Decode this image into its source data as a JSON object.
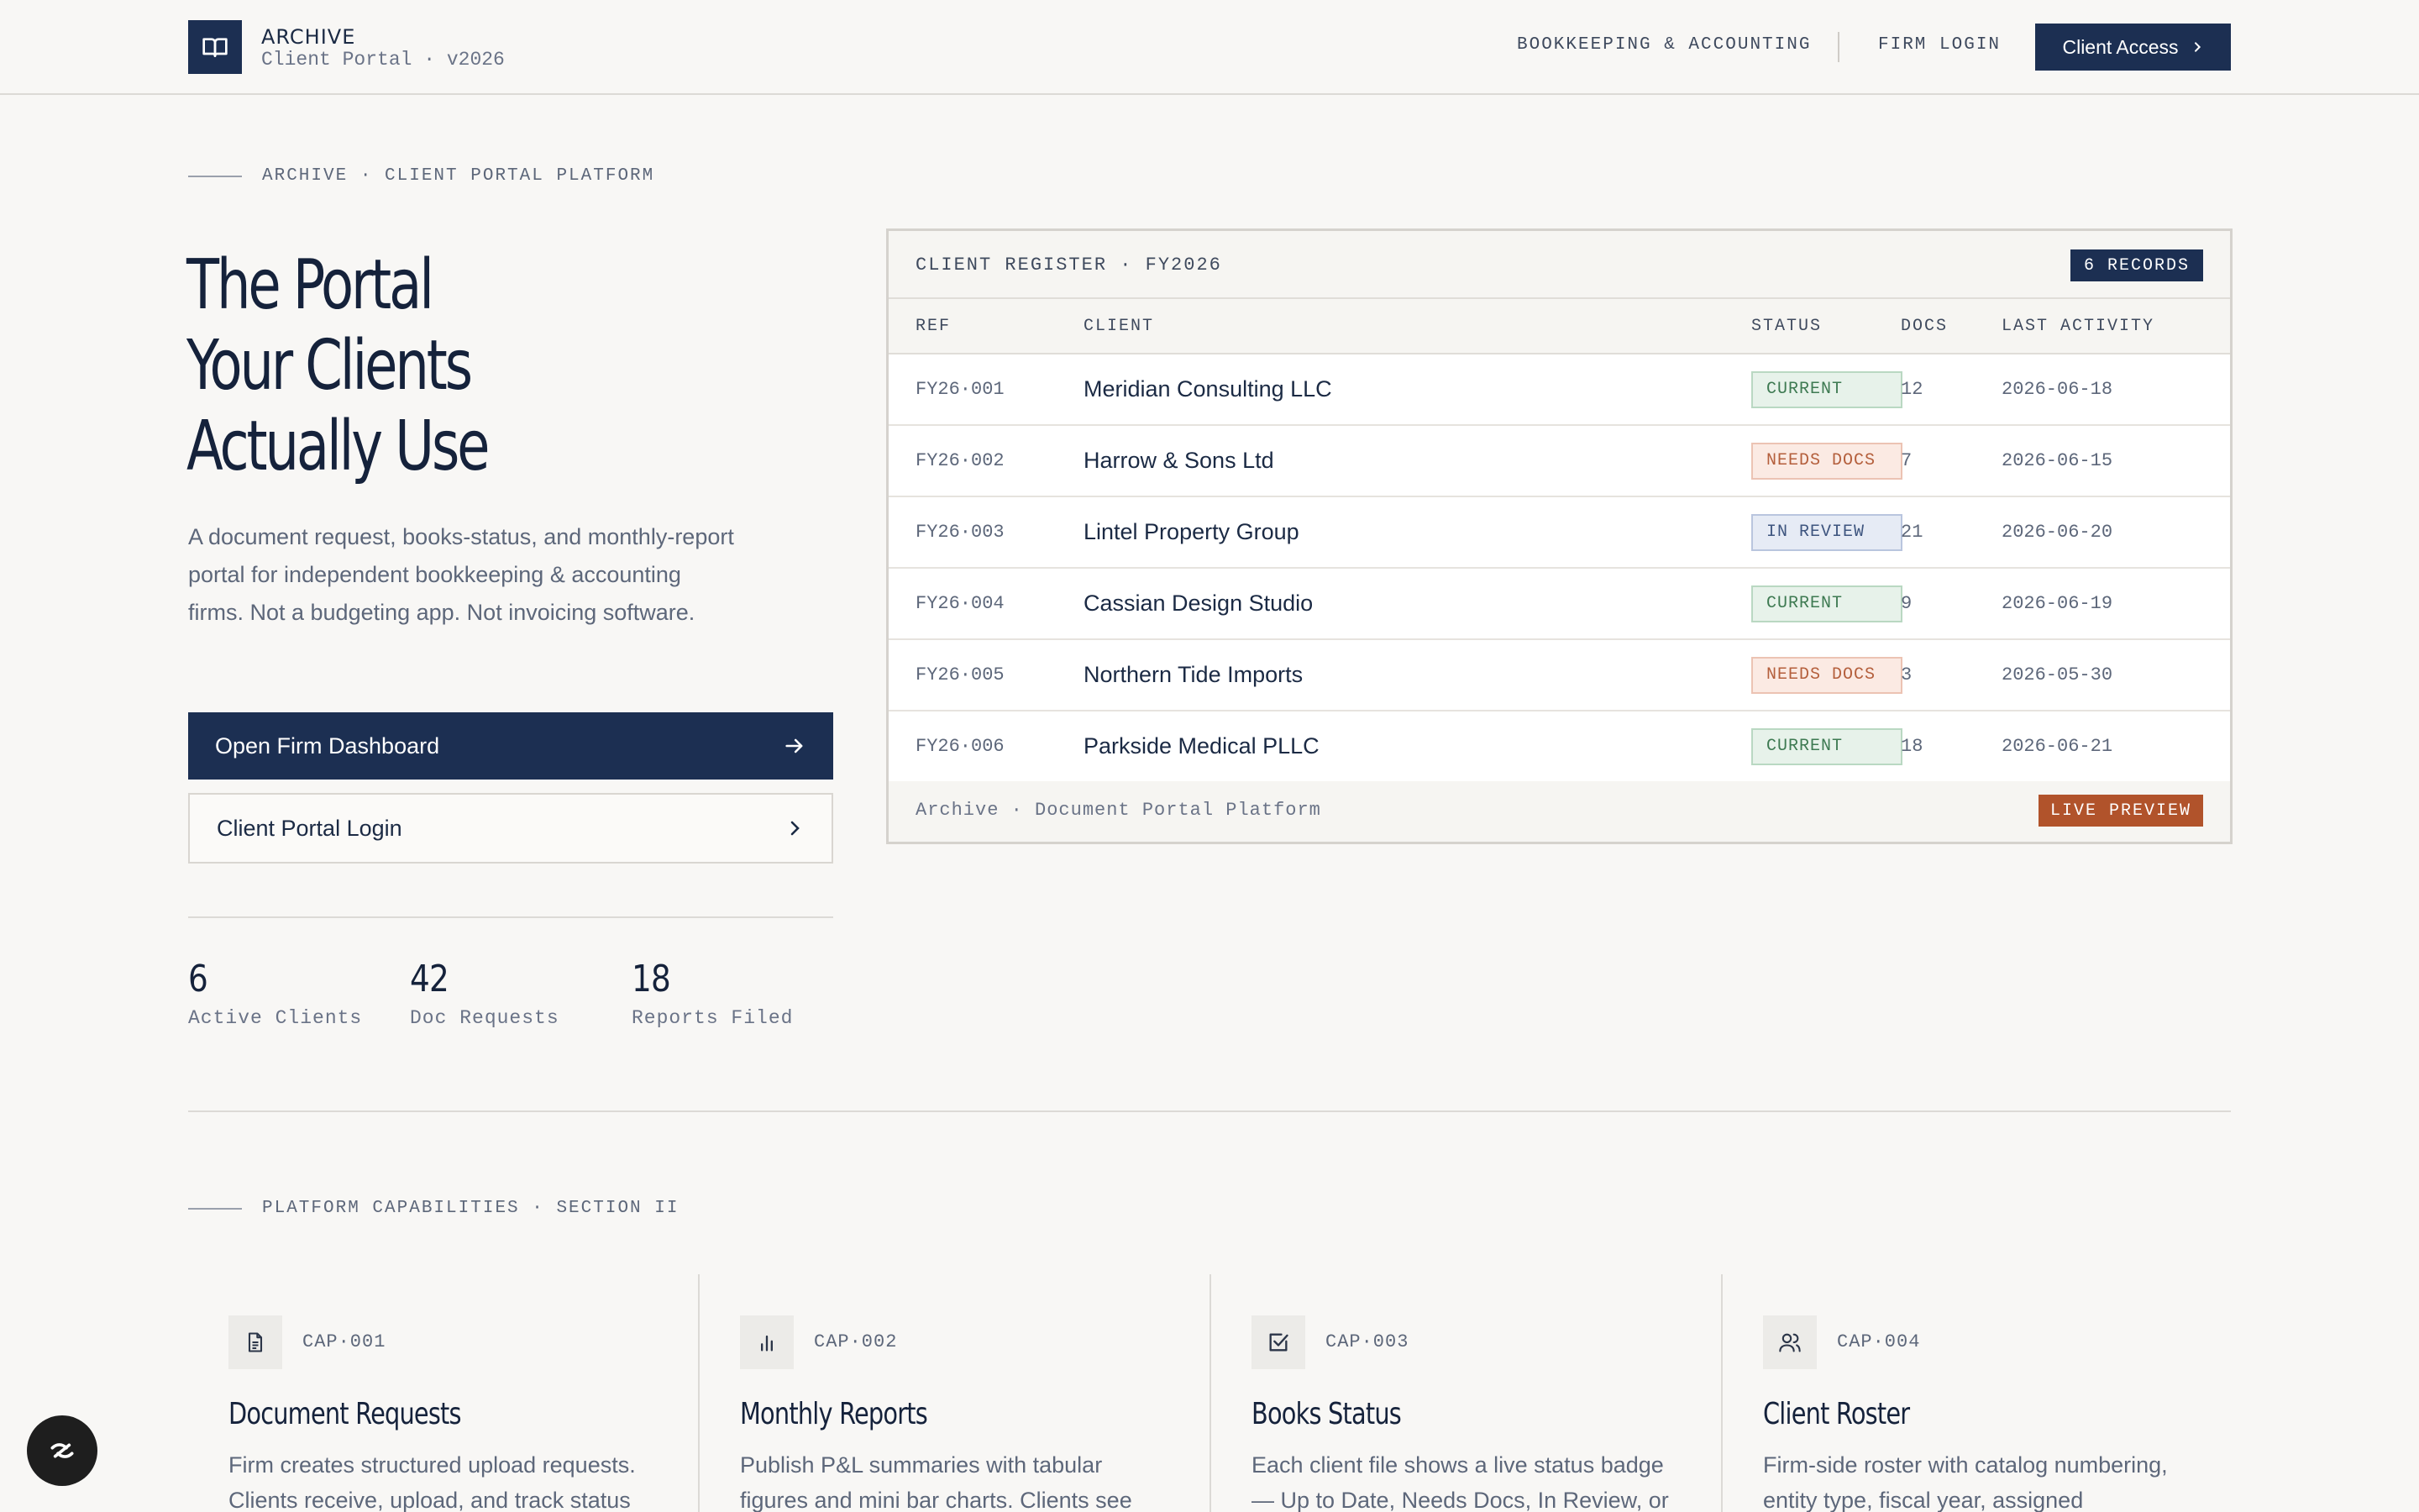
{
  "header": {
    "brand_name": "ARCHIVE",
    "brand_sub": "Client Portal · v2026",
    "nav": [
      "BOOKKEEPING & ACCOUNTING",
      "FIRM LOGIN"
    ],
    "cta_label": "Client Access"
  },
  "hero": {
    "eyebrow": "ARCHIVE · CLIENT PORTAL PLATFORM",
    "title_lines": [
      "The Portal",
      "Your Clients",
      "Actually Use"
    ],
    "description": "A document request, books-status, and monthly-report portal for independent bookkeeping & accounting firms. Not a budgeting app. Not invoicing software.",
    "primary_button": "Open Firm Dashboard",
    "secondary_button": "Client Portal Login",
    "stats": [
      {
        "value": "6",
        "label": "Active Clients"
      },
      {
        "value": "42",
        "label": "Doc Requests"
      },
      {
        "value": "18",
        "label": "Reports Filed"
      }
    ]
  },
  "register": {
    "title": "CLIENT REGISTER · FY2026",
    "records_badge": "6 RECORDS",
    "columns": [
      "REF",
      "CLIENT",
      "STATUS",
      "DOCS",
      "LAST ACTIVITY"
    ],
    "rows": [
      {
        "ref": "FY26·001",
        "client": "Meridian Consulting LLC",
        "status": "CURRENT",
        "docs": "12",
        "last": "2026-06-18"
      },
      {
        "ref": "FY26·002",
        "client": "Harrow & Sons Ltd",
        "status": "NEEDS DOCS",
        "docs": "7",
        "last": "2026-06-15"
      },
      {
        "ref": "FY26·003",
        "client": "Lintel Property Group",
        "status": "IN REVIEW",
        "docs": "21",
        "last": "2026-06-20"
      },
      {
        "ref": "FY26·004",
        "client": "Cassian Design Studio",
        "status": "CURRENT",
        "docs": "9",
        "last": "2026-06-19"
      },
      {
        "ref": "FY26·005",
        "client": "Northern Tide Imports",
        "status": "NEEDS DOCS",
        "docs": "3",
        "last": "2026-05-30"
      },
      {
        "ref": "FY26·006",
        "client": "Parkside Medical PLLC",
        "status": "CURRENT",
        "docs": "18",
        "last": "2026-06-21"
      }
    ],
    "footer_text": "Archive · Document Portal Platform",
    "live_badge": "LIVE PREVIEW"
  },
  "capabilities": {
    "eyebrow": "PLATFORM CAPABILITIES · SECTION II",
    "items": [
      {
        "code": "CAP·001",
        "icon": "document-icon",
        "title": "Document Requests",
        "desc": "Firm creates structured upload requests. Clients receive, upload, and track status"
      },
      {
        "code": "CAP·002",
        "icon": "bar-chart-icon",
        "title": "Monthly Reports",
        "desc": "Publish P&L summaries with tabular figures and mini bar charts. Clients see"
      },
      {
        "code": "CAP·003",
        "icon": "checkbox-icon",
        "title": "Books Status",
        "desc": "Each client file shows a live status badge — Up to Date, Needs Docs, In Review, or"
      },
      {
        "code": "CAP·004",
        "icon": "users-icon",
        "title": "Client Roster",
        "desc": "Firm-side roster with catalog numbering, entity type, fiscal year, assigned"
      }
    ]
  },
  "colors": {
    "navy": "#1c2f52",
    "accent_orange": "#b1532b",
    "status_current": "#3e7a52",
    "status_needs_docs": "#b45f3c",
    "status_in_review": "#3e557f"
  }
}
